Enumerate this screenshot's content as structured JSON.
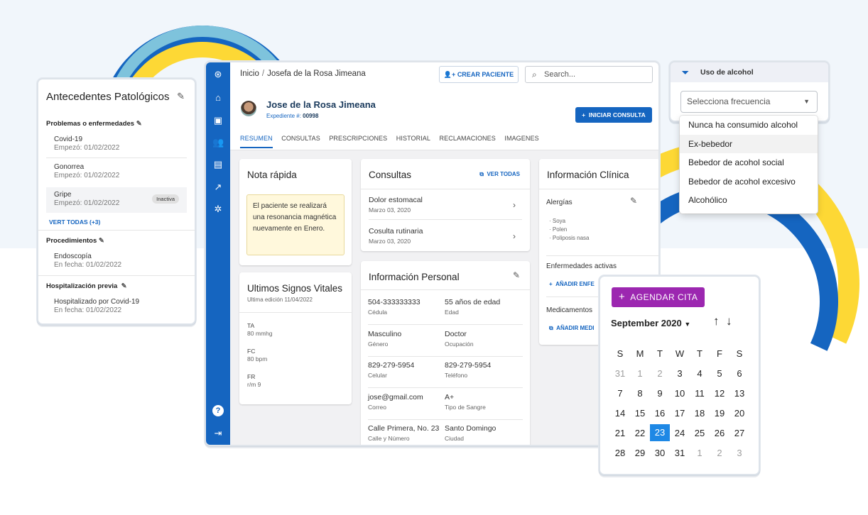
{
  "colors": {
    "primary": "#1565c0",
    "accent": "#9c27b0",
    "note_bg": "#fff8dc",
    "selected_day": "#1e88e5"
  },
  "antecedentes": {
    "title": "Antecedentes Patológicos",
    "problemas_header": "Problemas o enfermedades",
    "problemas": [
      {
        "name": "Covid-19",
        "date": "Empezó: 01/02/2022"
      },
      {
        "name": "Gonorrea",
        "date": "Empezó: 01/02/2022"
      },
      {
        "name": "Gripe",
        "date": "Empezó: 01/02/2022",
        "badge": "Inactiva"
      }
    ],
    "ver_todas": "VERT TODAS (+3)",
    "procedimientos_header": "Procedimientos",
    "procedimiento": {
      "name": "Endoscopía",
      "date": "En fecha: 01/02/2022"
    },
    "hosp_header": "Hospitalización previa",
    "hosp": {
      "name": "Hospitalizado por Covid-19",
      "date": "En fecha: 01/02/2022"
    }
  },
  "app": {
    "breadcrumb": {
      "home": "Inicio",
      "sep": "/",
      "current": "Josefa de la Rosa Jimeana"
    },
    "crear_paciente": "CREAR PACIENTE",
    "search_placeholder": "Search...",
    "patient": {
      "name": "Jose de la Rosa Jimeana",
      "exp_label": "Expediente #: ",
      "exp_num": "00998"
    },
    "iniciar": "INICIAR CONSULTA",
    "tabs": [
      "RESUMEN",
      "CONSULTAS",
      "PRESCRIPCIONES",
      "HISTORIAL",
      "RECLAMACIONES",
      "IMAGENES"
    ],
    "nota": {
      "title": "Nota rápida",
      "text": "El paciente se realizará una resonancia magnética nuevamente en Enero."
    },
    "signos": {
      "title": "Ultimos Signos Vitales",
      "edit": "Ultima edición 11/04/2022",
      "items": [
        {
          "k": "TA",
          "v": "80 mmhg"
        },
        {
          "k": "FC",
          "v": "80 bpm"
        },
        {
          "k": "FR",
          "v": "r/m 9"
        }
      ]
    },
    "consultas": {
      "title": "Consultas",
      "ver": "VER TODAS",
      "items": [
        {
          "t": "Dolor estomacal",
          "d": "Marzo 03, 2020"
        },
        {
          "t": "Cosulta rutinaria",
          "d": "Marzo 03, 2020"
        }
      ]
    },
    "personal": {
      "title": "Información Personal",
      "rows": [
        [
          {
            "v": "504-333333333",
            "l": "Cédula"
          },
          {
            "v": "55 años de edad",
            "l": "Edad"
          }
        ],
        [
          {
            "v": "Masculino",
            "l": "Género"
          },
          {
            "v": "Doctor",
            "l": "Ocupación"
          }
        ],
        [
          {
            "v": "829-279-5954",
            "l": "Celular"
          },
          {
            "v": "829-279-5954",
            "l": "Teléfono"
          }
        ],
        [
          {
            "v": "jose@gmail.com",
            "l": "Correo"
          },
          {
            "v": "A+",
            "l": "Tipo de Sangre"
          }
        ],
        [
          {
            "v": "Calle Primera, No. 23",
            "l": "Calle y Número"
          },
          {
            "v": "Santo Domingo",
            "l": "Ciudad"
          }
        ]
      ]
    },
    "clinica": {
      "title": "Información Clínica",
      "alergias": "Alergías",
      "alergias_list": [
        "Soya",
        "Polen",
        "Poliposis nasa"
      ],
      "enfermedades": "Enfermedades activas",
      "add_enf": "AÑADIR ENFE",
      "medicamentos": "Medicamentos",
      "add_med": "AÑADIR MEDI"
    }
  },
  "alcohol": {
    "title": "Uso de alcohol",
    "placeholder": "Selecciona frecuencia",
    "options": [
      "Nunca ha consumido alcohol",
      "Ex-bebedor",
      "Bebedor de acohol social",
      "Bebedor de acohol excesivo",
      "Alcohólico"
    ],
    "highlighted": 1
  },
  "calendar": {
    "agendar": "AGENDAR CITA",
    "month": "September 2020",
    "selected": 23,
    "weekdays": [
      "S",
      "M",
      "T",
      "W",
      "T",
      "F",
      "S"
    ],
    "weeks": [
      [
        {
          "d": "31",
          "o": true
        },
        {
          "d": "1",
          "o": true
        },
        {
          "d": "2",
          "o": true
        },
        {
          "d": "3"
        },
        {
          "d": "4"
        },
        {
          "d": "5"
        },
        {
          "d": "6"
        }
      ],
      [
        {
          "d": "7"
        },
        {
          "d": "8"
        },
        {
          "d": "9"
        },
        {
          "d": "10"
        },
        {
          "d": "11"
        },
        {
          "d": "12"
        },
        {
          "d": "13"
        }
      ],
      [
        {
          "d": "14"
        },
        {
          "d": "15"
        },
        {
          "d": "16"
        },
        {
          "d": "17"
        },
        {
          "d": "18"
        },
        {
          "d": "19"
        },
        {
          "d": "20"
        }
      ],
      [
        {
          "d": "21"
        },
        {
          "d": "22"
        },
        {
          "d": "23"
        },
        {
          "d": "24"
        },
        {
          "d": "25"
        },
        {
          "d": "26"
        },
        {
          "d": "27"
        }
      ],
      [
        {
          "d": "28"
        },
        {
          "d": "29"
        },
        {
          "d": "30"
        },
        {
          "d": "31"
        },
        {
          "d": "1",
          "o": true
        },
        {
          "d": "2",
          "o": true
        },
        {
          "d": "3",
          "o": true
        }
      ]
    ]
  }
}
